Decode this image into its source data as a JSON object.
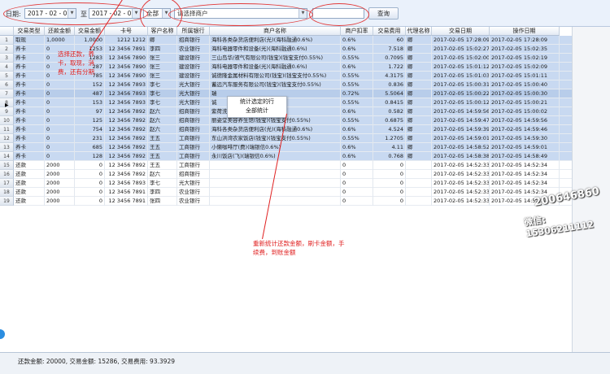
{
  "toolbar": {
    "date_label": "日期:",
    "date_from": "2017 - 02 - 01",
    "to_label": "至",
    "date_to": "2017 - 02 - 05",
    "all_option": "全部",
    "merchant_placeholder": "请选择商户",
    "search_text": "",
    "query_button": "查询"
  },
  "columns": [
    "交易类型",
    "还款金额",
    "交易金额",
    "卡号",
    "客户名称",
    "所属银行",
    "商户名称",
    "商户扣率",
    "交易费用",
    "代理名称",
    "交易日期",
    "操作日期"
  ],
  "rows": [
    {
      "n": "1",
      "type": "取现",
      "repay": "1,0000",
      "amount": "1,0000",
      "card": "1212 1212",
      "customer": "卿",
      "bank": "招商银行",
      "merchant": "海科各类杂货店便利店(光)(海科融通0.6%)",
      "rate": "0.6%",
      "fee": "60",
      "agent": "卿",
      "txdate": "2017-02-05 17:28:09",
      "opdate": "2017-02-05 17:28:09"
    },
    {
      "n": "2",
      "type": "养卡",
      "repay": "0",
      "amount": "1253",
      "card": "12 3456 7891",
      "customer": "李四",
      "bank": "农业银行",
      "merchant": "海科电器零件和设备(光)(海科融通0.6%)",
      "rate": "0.6%",
      "fee": "7.518",
      "agent": "卿",
      "txdate": "2017-02-05 15:02:27",
      "opdate": "2017-02-05 15:02:35"
    },
    {
      "n": "3",
      "type": "养卡",
      "repay": "0",
      "amount": "1283",
      "card": "12 3456 7890",
      "customer": "张三",
      "bank": "建设银行",
      "merchant": "三山岛华/液气有限公司(钱宝)(钱宝支付0.55%)",
      "rate": "0.55%",
      "fee": "0.7095",
      "agent": "卿",
      "txdate": "2017-02-05 15:02:00",
      "opdate": "2017-02-05 15:02:19"
    },
    {
      "n": "4",
      "type": "养卡",
      "repay": "0",
      "amount": "287",
      "card": "12 3456 7890",
      "customer": "张三",
      "bank": "建设银行",
      "merchant": "海科电器零件和设备(光)(海科融通0.6%)",
      "rate": "0.6%",
      "fee": "1.722",
      "agent": "卿",
      "txdate": "2017-02-05 15:01:12",
      "opdate": "2017-02-05 15:02:09"
    },
    {
      "n": "5",
      "type": "养卡",
      "repay": "0",
      "amount": "785",
      "card": "12 3456 7890",
      "customer": "张三",
      "bank": "建设银行",
      "merchant": "诚德隆金属材料有限公司(钱宝)(钱宝支付0.55%)",
      "rate": "0.55%",
      "fee": "4.3175",
      "agent": "卿",
      "txdate": "2017-02-05 15:01:03",
      "opdate": "2017-02-05 15:01:11"
    },
    {
      "n": "6",
      "type": "养卡",
      "repay": "0",
      "amount": "152",
      "card": "12 3456 7893",
      "customer": "李七",
      "bank": "光大银行",
      "merchant": "蓄远汽车服务有限公司(钱宝)(钱宝支付0.55%)",
      "rate": "0.55%",
      "fee": "0.836",
      "agent": "卿",
      "txdate": "2017-02-05 15:00:31",
      "opdate": "2017-02-05 15:00:40"
    },
    {
      "n": "7",
      "type": "养卡",
      "repay": "0",
      "amount": "487",
      "card": "12 3456 7893",
      "customer": "李七",
      "bank": "光大银行",
      "merchant": "瑞",
      "rate": "0.72%",
      "fee": "5.5064",
      "agent": "卿",
      "txdate": "2017-02-05 15:00:22",
      "opdate": "2017-02-05 15:00:30"
    },
    {
      "n": "8",
      "type": "养卡",
      "repay": "0",
      "amount": "153",
      "card": "12 3456 7893",
      "customer": "李七",
      "bank": "光大银行",
      "merchant": "诚",
      "rate": "0.55%",
      "fee": "0.8415",
      "agent": "卿",
      "txdate": "2017-02-05 15:00:12",
      "opdate": "2017-02-05 15:00:21"
    },
    {
      "n": "9",
      "type": "养卡",
      "repay": "0",
      "amount": "97",
      "card": "12 3456 7892",
      "customer": "赵六",
      "bank": "招商银行",
      "merchant": "紫荷洗浴中心(费)(瑞银信0.6%)",
      "rate": "0.6%",
      "fee": "0.582",
      "agent": "卿",
      "txdate": "2017-02-05 14:59:56",
      "opdate": "2017-02-05 15:00:02"
    },
    {
      "n": "10",
      "type": "养卡",
      "repay": "0",
      "amount": "125",
      "card": "12 3456 7892",
      "customer": "赵六",
      "bank": "招商银行",
      "merchant": "丽姿堂美容养生馆(钱宝)(钱宝支付0.55%)",
      "rate": "0.55%",
      "fee": "0.6875",
      "agent": "卿",
      "txdate": "2017-02-05 14:59:47",
      "opdate": "2017-02-05 14:59:56"
    },
    {
      "n": "11",
      "type": "养卡",
      "repay": "0",
      "amount": "754",
      "card": "12 3456 7892",
      "customer": "赵六",
      "bank": "招商银行",
      "merchant": "海科各类杂货店便利店(光)(海科融通0.6%)",
      "rate": "0.6%",
      "fee": "4.524",
      "agent": "卿",
      "txdate": "2017-02-05 14:59:39",
      "opdate": "2017-02-05 14:59:46"
    },
    {
      "n": "12",
      "type": "养卡",
      "repay": "0",
      "amount": "231",
      "card": "12 3456 7892",
      "customer": "王五",
      "bank": "工商银行",
      "merchant": "东山洪湾农家饭店(钱宝)(钱宝支付0.55%)",
      "rate": "0.55%",
      "fee": "1.2705",
      "agent": "卿",
      "txdate": "2017-02-05 14:59:01",
      "opdate": "2017-02-05 14:59:30"
    },
    {
      "n": "13",
      "type": "养卡",
      "repay": "0",
      "amount": "685",
      "card": "12 3456 7892",
      "customer": "王五",
      "bank": "工商银行",
      "merchant": "小懒咖啡厅(费)(瑞银信0.6%)",
      "rate": "0.6%",
      "fee": "4.11",
      "agent": "卿",
      "txdate": "2017-02-05 14:58:52",
      "opdate": "2017-02-05 14:59:01"
    },
    {
      "n": "14",
      "type": "养卡",
      "repay": "0",
      "amount": "128",
      "card": "12 3456 7892",
      "customer": "王五",
      "bank": "工商银行",
      "merchant": "永川饭店(飞)(瑞银信0.6%)",
      "rate": "0.6%",
      "fee": "0.768",
      "agent": "卿",
      "txdate": "2017-02-05 14:58:38",
      "opdate": "2017-02-05 14:58:49"
    },
    {
      "n": "15",
      "type": "还款",
      "repay": "2000",
      "amount": "0",
      "card": "12 3456 7892",
      "customer": "王五",
      "bank": "工商银行",
      "merchant": "",
      "rate": "0",
      "fee": "0",
      "agent": "",
      "txdate": "2017-02-05 14:52:33",
      "opdate": "2017-02-05 14:52:34"
    },
    {
      "n": "16",
      "type": "还款",
      "repay": "2000",
      "amount": "0",
      "card": "12 3456 7892",
      "customer": "赵六",
      "bank": "招商银行",
      "merchant": "",
      "rate": "0",
      "fee": "0",
      "agent": "",
      "txdate": "2017-02-05 14:52:33",
      "opdate": "2017-02-05 14:52:34"
    },
    {
      "n": "17",
      "type": "还款",
      "repay": "2000",
      "amount": "0",
      "card": "12 3456 7893",
      "customer": "李七",
      "bank": "光大银行",
      "merchant": "",
      "rate": "0",
      "fee": "0",
      "agent": "",
      "txdate": "2017-02-05 14:52:33",
      "opdate": "2017-02-05 14:52:34"
    },
    {
      "n": "18",
      "type": "还款",
      "repay": "2000",
      "amount": "0",
      "card": "12 3456 7891",
      "customer": "李四",
      "bank": "农业银行",
      "merchant": "",
      "rate": "0",
      "fee": "0",
      "agent": "",
      "txdate": "2017-02-05 14:52:33",
      "opdate": "2017-02-05 14:52:34"
    },
    {
      "n": "19",
      "type": "还款",
      "repay": "2000",
      "amount": "0",
      "card": "12 3456 7891",
      "customer": "张四",
      "bank": "农业银行",
      "merchant": "",
      "rate": "0",
      "fee": "0",
      "agent": "",
      "txdate": "2017-02-05 14:52:33",
      "opdate": "2017-02-05 14:52:34"
    }
  ],
  "popup": {
    "item1": "统计选定的行",
    "item2": "全部统计"
  },
  "annotations": {
    "left_1": "选择还款，养",
    "left_2": "卡，取现，消",
    "left_3": "费，还有分期",
    "bottom_1": "重新统计还款金额，刷卡金额，手",
    "bottom_2": "续费，到账金额"
  },
  "status": {
    "summary": "还款金额: 20000, 交易金额: 15286, 交易费用: 93.3929"
  },
  "watermark": {
    "line1": "200646860",
    "line2": "微信: 15306211112"
  },
  "colors": {
    "highlight": "#e23b3b",
    "selected_row": "#c8d9f1"
  }
}
